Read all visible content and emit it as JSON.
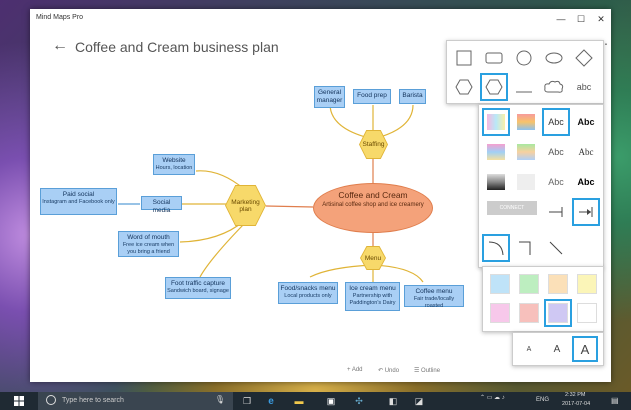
{
  "window": {
    "app_title": "Mind Maps Pro",
    "minimize": "—",
    "maximize": "☐",
    "close": "✕"
  },
  "header": {
    "title": "Coffee and Cream business plan",
    "back": "←",
    "more": "⋯"
  },
  "center": {
    "title": "Coffee and Cream",
    "subtitle": "Artisinal coffee shop and ice creamery"
  },
  "hubs": {
    "staffing": "Staffing",
    "marketing": "Marketing plan",
    "menu": "Menu"
  },
  "staffing_nodes": [
    {
      "title": "General manager"
    },
    {
      "title": "Food prep"
    },
    {
      "title": "Barista"
    }
  ],
  "marketing_nodes": [
    {
      "title": "Website",
      "sub": "Hours, location"
    },
    {
      "title": "Social media",
      "sub": ""
    },
    {
      "title": "Paid social",
      "sub": "Instagram and Facebook only"
    },
    {
      "title": "Word of mouth",
      "sub": "Free ice cream when you bring a friend"
    },
    {
      "title": "Foot traffic capture",
      "sub": "Sandwich board, signage"
    }
  ],
  "menu_nodes": [
    {
      "title": "Food/snacks menu",
      "sub": "Local products only"
    },
    {
      "title": "Ice cream menu",
      "sub": "Partnership with Paddington's Dairy"
    },
    {
      "title": "Coffee menu",
      "sub": "Fair trade/locally roasted"
    }
  ],
  "bottom_bar": {
    "add": "+ Add",
    "undo": "↶ Undo",
    "outline": "☰ Outline"
  },
  "shapes_panel": {
    "abc": "abc"
  },
  "style_panel": {
    "abc_labels": [
      "Abc",
      "Abc",
      "Abc",
      "Abc",
      "Abc",
      "Abc"
    ],
    "connect_label": "CONNECT"
  },
  "colors": {
    "swatches": [
      "#bfe3f8",
      "#bdeec0",
      "#fbe0b8",
      "#fbf5b8",
      "#f7c8ea",
      "#f7c0bc",
      "#cfc8f3",
      "#ffffff"
    ],
    "accent": "#2aa0e0"
  },
  "font_sizes": [
    "A",
    "A",
    "A"
  ],
  "taskbar": {
    "search_placeholder": "Type here to search",
    "lang": "ENG",
    "time": "2:32 PM",
    "date": "2017-07-04"
  }
}
